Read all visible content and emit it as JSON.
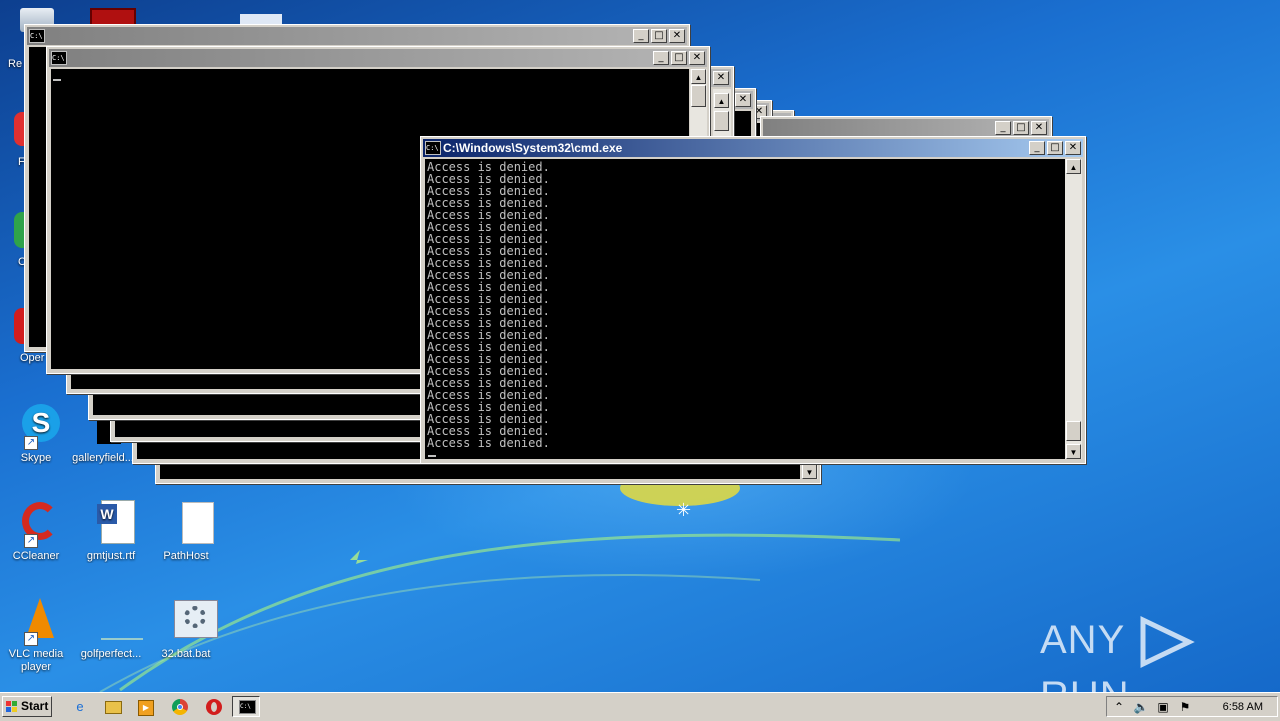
{
  "desktop": {
    "partial_labels": [
      "Re",
      "F",
      "C",
      "Oper"
    ],
    "icons": [
      {
        "label": "Skype"
      },
      {
        "label": "galleryfield..."
      },
      {
        "label": "CCleaner"
      },
      {
        "label": "gmtjust.rtf"
      },
      {
        "label": "PathHost"
      },
      {
        "label": "VLC media player"
      },
      {
        "label": "golfperfect..."
      },
      {
        "label": "32.bat.bat"
      }
    ]
  },
  "windows": {
    "active": {
      "title": "C:\\Windows\\System32\\cmd.exe",
      "lines": [
        "Access is denied.",
        "Access is denied.",
        "Access is denied.",
        "Access is denied.",
        "Access is denied.",
        "Access is denied.",
        "Access is denied.",
        "Access is denied.",
        "Access is denied.",
        "Access is denied.",
        "Access is denied.",
        "Access is denied.",
        "Access is denied.",
        "Access is denied.",
        "Access is denied.",
        "Access is denied.",
        "Access is denied.",
        "Access is denied.",
        "Access is denied.",
        "Access is denied.",
        "Access is denied.",
        "Access is denied.",
        "Access is denied.",
        "Access is denied."
      ]
    },
    "controls": {
      "minimize": "_",
      "maximize": "□",
      "close": "✕"
    },
    "title_icon": "C:\\"
  },
  "taskbar": {
    "start_label": "Start",
    "quick_launch": [
      "ie-icon",
      "explorer-icon",
      "media-player-icon",
      "chrome-icon",
      "opera-icon"
    ],
    "tray_icons": [
      "show-hidden-icon",
      "volume-icon",
      "network-icon",
      "action-center-flag-icon"
    ],
    "clock": "6:58 AM"
  },
  "watermark": {
    "left": "ANY",
    "right": "RUN"
  }
}
